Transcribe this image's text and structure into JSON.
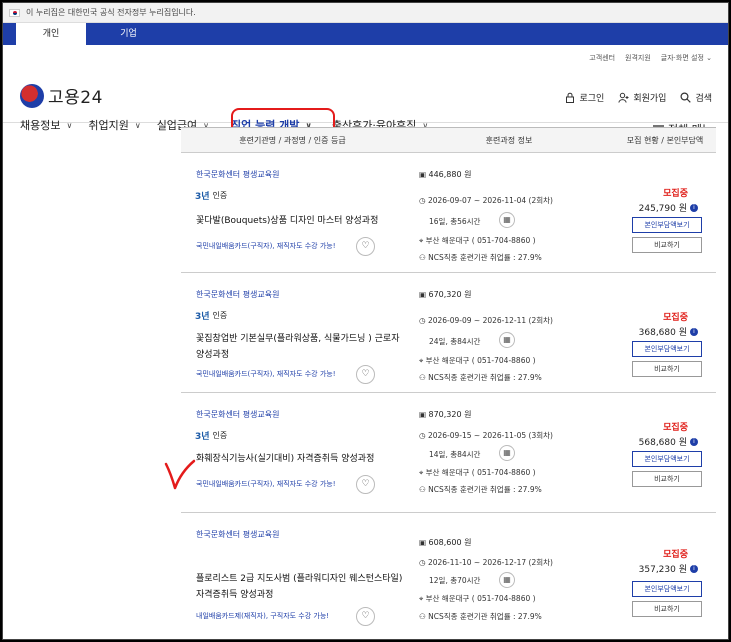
{
  "gov_banner": "이 누리집은 대한민국 공식 전자정부 누리집입니다.",
  "top_tabs": [
    "개인",
    "기업"
  ],
  "utility_links": [
    "고객센터",
    "원격지원",
    "글자·화면 설정"
  ],
  "logo_text": "고용24",
  "user_links": {
    "login": "로그인",
    "signup": "회원가입",
    "search": "검색"
  },
  "nav": [
    "채용정보",
    "취업지원",
    "실업급여",
    "직업 능력 개발",
    "출산휴가·육아휴직"
  ],
  "menu_all": "전체 메뉴",
  "table_headers": [
    "훈련기관명 / 과정명 / 인증 등급",
    "훈련과정 정보",
    "모집 현황 / 본인부담액"
  ],
  "cert_badge": "3년",
  "cert_label": "인증",
  "btn_self_pay": "본인부담액보기",
  "btn_compare": "비교하기",
  "rows": [
    {
      "institution": "한국문화센터 평생교육원",
      "title": "꽃다발(Bouquets)상품 디자인 마스터 양성과정",
      "card": "국민내일배움카드(구직자), 재직자도 수강 가능!",
      "price": "446,880 원",
      "period": "2026-09-07 ~ 2026-11-04 (2회차)",
      "days": "16일, 총56시간",
      "location": "부산 해운대구 ( 051-704-8860 )",
      "ncs": "NCS직종 훈련기관 취업률 : 27.9%",
      "status": "모집중",
      "amount": "245,790 원"
    },
    {
      "institution": "한국문화센터 평생교육원",
      "title": "꽃집창업반 기본실무(플라워상품, 식물가드닝 ) 근로자 양성과정",
      "card": "국민내일배움카드(구직자), 재직자도 수강 가능!",
      "price": "670,320 원",
      "period": "2026-09-09 ~ 2026-12-11 (2회차)",
      "days": "24일, 총84시간",
      "location": "부산 해운대구 ( 051-704-8860 )",
      "ncs": "NCS직종 훈련기관 취업률 : 27.9%",
      "status": "모집중",
      "amount": "368,680 원"
    },
    {
      "institution": "한국문화센터 평생교육원",
      "title": "화훼장식기능사(실기대비) 자격증취득 양성과정",
      "card": "국민내일배움카드(구직자), 재직자도 수강 가능!",
      "price": "870,320 원",
      "period": "2026-09-15 ~ 2026-11-05 (3회차)",
      "days": "14일, 총84시간",
      "location": "부산 해운대구 ( 051-704-8860 )",
      "ncs": "NCS직종 훈련기관 취업률 : 27.9%",
      "status": "모집중",
      "amount": "568,680 원"
    },
    {
      "institution": "한국문화센터 평생교육원",
      "title": "플로리스트 2급 지도사범 (플라워디자인 웨스턴스타일) 자격증취득 양성과정",
      "card": "내일배움카드제(재직자), 구직자도 수강 가능!",
      "price": "608,600 원",
      "period": "2026-11-10 ~ 2026-12-17 (2회차)",
      "days": "12일, 총70시간",
      "location": "부산 해운대구 ( 051-704-8860 )",
      "ncs": "NCS직종 훈련기관 취업률 : 27.9%",
      "status": "모집중",
      "amount": "357,230 원"
    }
  ],
  "colors": {
    "brand": "#1e3ea8",
    "recruit": "#e0201b",
    "annotation": "#e41b1b"
  }
}
